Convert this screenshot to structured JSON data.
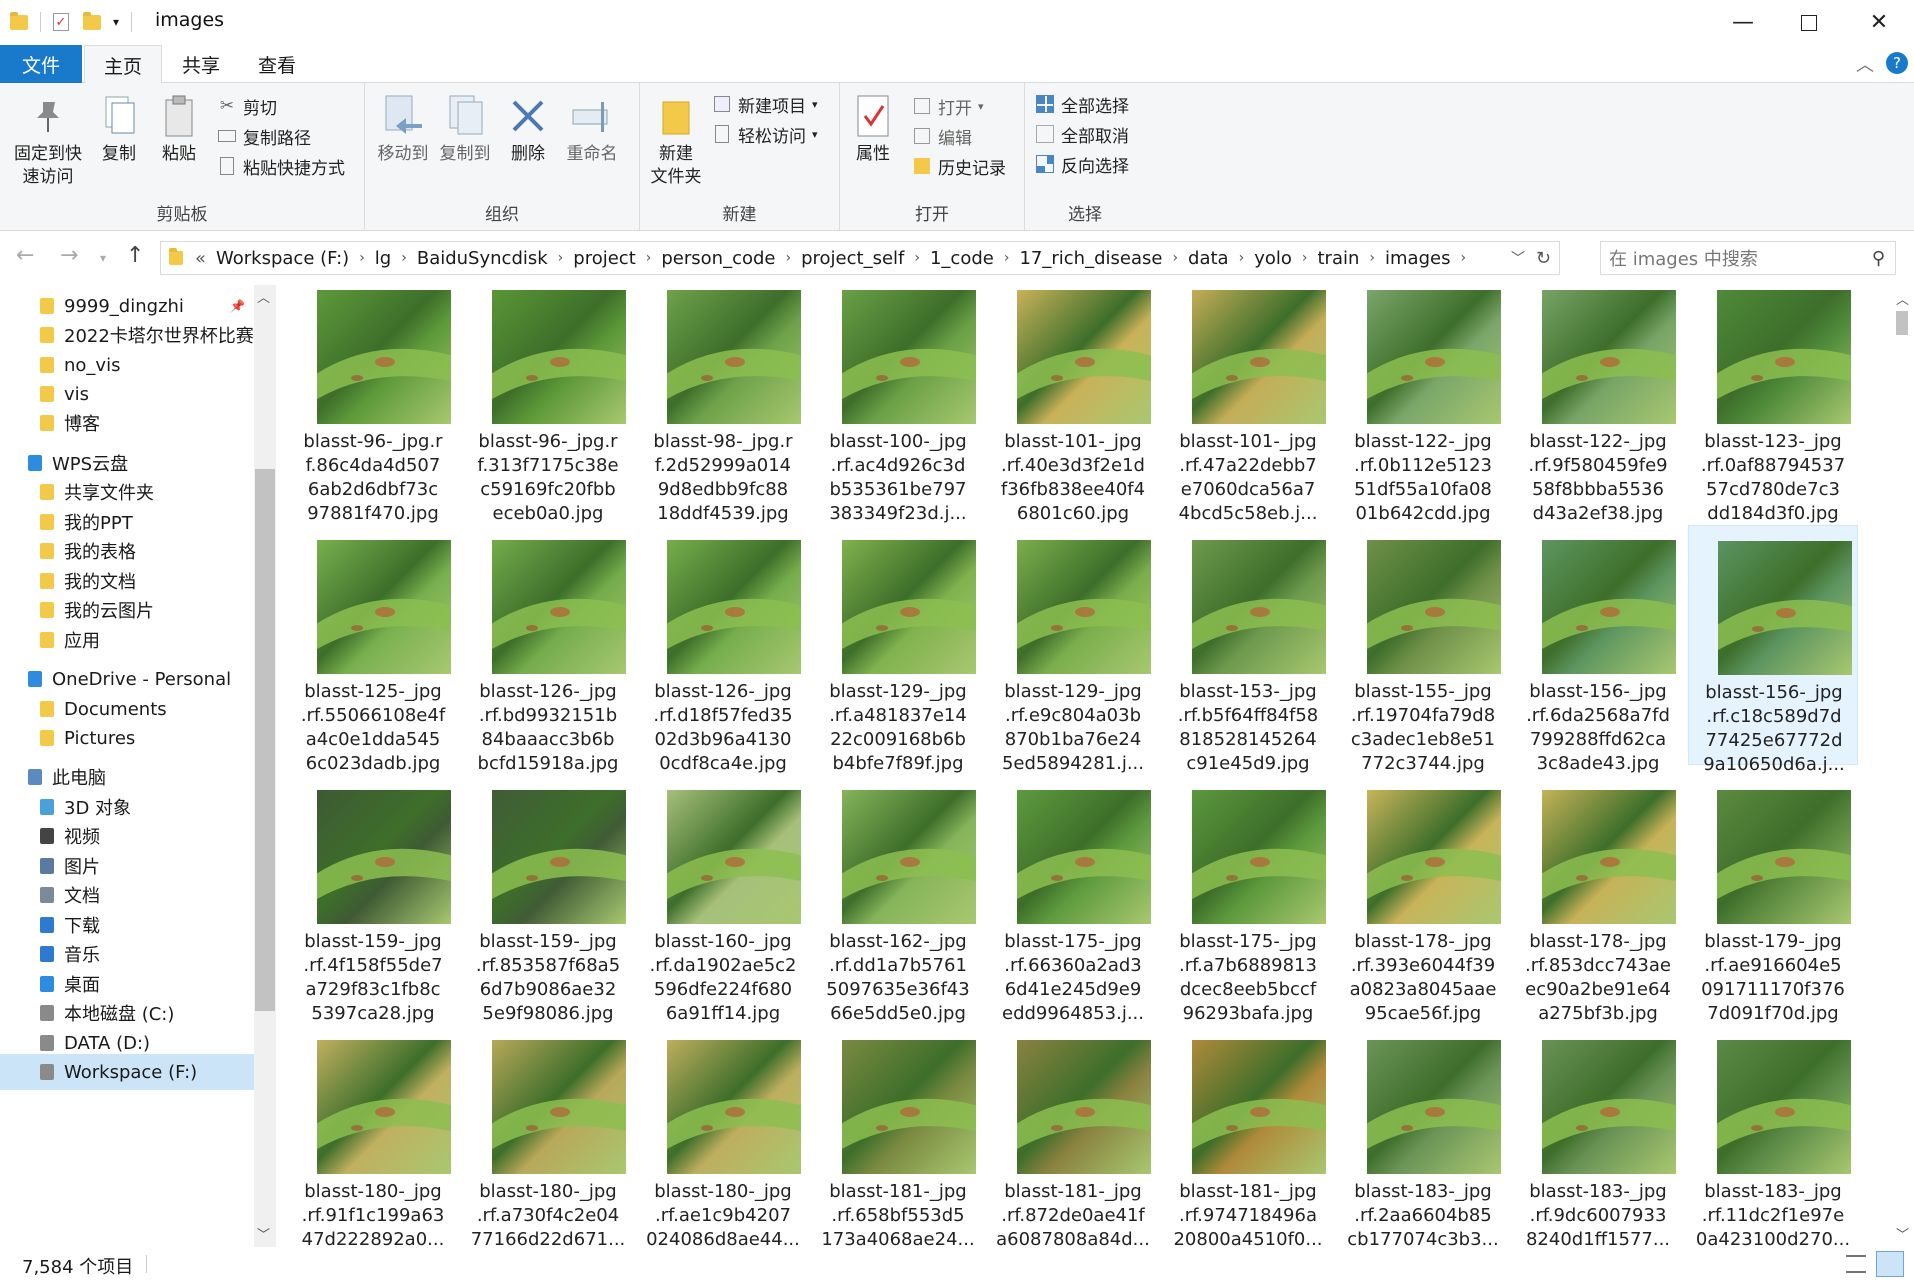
{
  "window": {
    "title": "images"
  },
  "tabs": {
    "file": "文件",
    "home": "主页",
    "share": "共享",
    "view": "查看"
  },
  "ribbon": {
    "clipboard": {
      "pin": "固定到快\n速访问",
      "copy": "复制",
      "paste": "粘贴",
      "cut": "剪切",
      "copy_path": "复制路径",
      "paste_shortcut": "粘贴快捷方式",
      "label": "剪贴板"
    },
    "organize": {
      "move_to": "移动到",
      "copy_to": "复制到",
      "delete": "删除",
      "rename": "重命名",
      "label": "组织"
    },
    "new": {
      "new_folder": "新建\n文件夹",
      "new_item": "新建项目",
      "easy_access": "轻松访问",
      "label": "新建"
    },
    "open": {
      "properties": "属性",
      "open": "打开",
      "edit": "编辑",
      "history": "历史记录",
      "label": "打开"
    },
    "select": {
      "select_all": "全部选择",
      "select_none": "全部取消",
      "invert": "反向选择",
      "label": "选择"
    }
  },
  "address": {
    "overflow": "«",
    "crumbs": [
      "Workspace (F:)",
      "lg",
      "BaiduSyncdisk",
      "project",
      "person_code",
      "project_self",
      "1_code",
      "17_rich_disease",
      "data",
      "yolo",
      "train",
      "images"
    ],
    "search_placeholder": "在 images 中搜索"
  },
  "nav": {
    "items": [
      {
        "label": "9999_dingzhi",
        "icon": "folder-icon"
      },
      {
        "label": "2022卡塔尔世界杯比赛",
        "icon": "folder-icon"
      },
      {
        "label": "no_vis",
        "icon": "folder-icon"
      },
      {
        "label": "vis",
        "icon": "folder-icon"
      },
      {
        "label": "博客",
        "icon": "folder-icon"
      },
      {
        "label": "WPS云盘",
        "icon": "cloud-icon"
      },
      {
        "label": "共享文件夹",
        "icon": "shared-folder-icon"
      },
      {
        "label": "我的PPT",
        "icon": "folder-icon"
      },
      {
        "label": "我的表格",
        "icon": "folder-icon"
      },
      {
        "label": "我的文档",
        "icon": "folder-icon"
      },
      {
        "label": "我的云图片",
        "icon": "folder-icon"
      },
      {
        "label": "应用",
        "icon": "apps-folder-icon"
      },
      {
        "label": "OneDrive - Personal",
        "icon": "onedrive-icon"
      },
      {
        "label": "Documents",
        "icon": "folder-icon"
      },
      {
        "label": "Pictures",
        "icon": "folder-icon"
      },
      {
        "label": "此电脑",
        "icon": "computer-icon"
      },
      {
        "label": "3D 对象",
        "icon": "3d-objects-icon"
      },
      {
        "label": "视频",
        "icon": "video-icon"
      },
      {
        "label": "图片",
        "icon": "pictures-icon"
      },
      {
        "label": "文档",
        "icon": "documents-icon"
      },
      {
        "label": "下载",
        "icon": "download-icon"
      },
      {
        "label": "音乐",
        "icon": "music-icon"
      },
      {
        "label": "桌面",
        "icon": "desktop-icon"
      },
      {
        "label": "本地磁盘 (C:)",
        "icon": "drive-icon"
      },
      {
        "label": "DATA (D:)",
        "icon": "drive-icon"
      },
      {
        "label": "Workspace (F:)",
        "icon": "drive-icon"
      }
    ]
  },
  "files": [
    {
      "name": "blasst-96-_jpg.r\nf.86c4da4d507\n6ab2d6dbf73c\n97881f470.jpg",
      "bg": "#5e9a3a"
    },
    {
      "name": "blasst-96-_jpg.r\nf.313f7175c38e\nc59169fc20fbb\neceb0a0.jpg",
      "bg": "#5a9636"
    },
    {
      "name": "blasst-98-_jpg.r\nf.2d52999a014\n9d8edbb9fc88\n18ddf4539.jpg",
      "bg": "#6ea24a"
    },
    {
      "name": "blasst-100-_jpg\n.rf.ac4d926c3d\nb535361be797\n383349f23d.j...",
      "bg": "#6aa046"
    },
    {
      "name": "blasst-101-_jpg\n.rf.40e3d3f2e1d\nf36fb838ee40f4\n6801c60.jpg",
      "bg": "#c9b25a"
    },
    {
      "name": "blasst-101-_jpg\n.rf.47a22debb7\ne7060dca56a7\n4bcd5c58eb.j...",
      "bg": "#c4ad58"
    },
    {
      "name": "blasst-122-_jpg\n.rf.0b112e5123\n51df55a10fa08\n01b642cdd.jpg",
      "bg": "#7aa66a"
    },
    {
      "name": "blasst-122-_jpg\n.rf.9f580459fe9\n58f8bbba5536\nd43a2ef38.jpg",
      "bg": "#77a466"
    },
    {
      "name": "blasst-123-_jpg\n.rf.0af88794537\n57cd780de7c3\ndd184d3f0.jpg",
      "bg": "#4f8a3a"
    },
    {
      "name": "blasst-125-_jpg\n.rf.55066108e4f\na4c0e1dda545\n6c023dadb.jpg",
      "bg": "#78b04e"
    },
    {
      "name": "blasst-126-_jpg\n.rf.bd9932151b\n84baaacc3b6b\nbcfd15918a.jpg",
      "bg": "#74ac4c"
    },
    {
      "name": "blasst-126-_jpg\n.rf.d18f57fed35\n02d3b96a4130\n0cdf8ca4e.jpg",
      "bg": "#76ae4c"
    },
    {
      "name": "blasst-129-_jpg\n.rf.a481837e14\n22c009168b6b\nb4bfe7f89f.jpg",
      "bg": "#80b24e"
    },
    {
      "name": "blasst-129-_jpg\n.rf.e9c804a03b\n870b1ba76e24\n5ed5894281.j...",
      "bg": "#7aae4c"
    },
    {
      "name": "blasst-153-_jpg\n.rf.b5f64ff84f58\n818528145264\nc91e45d9.jpg",
      "bg": "#6e9a4e"
    },
    {
      "name": "blasst-155-_jpg\n.rf.19704fa79d8\nc3adec1eb8e51\n772c3744.jpg",
      "bg": "#6f9048"
    },
    {
      "name": "blasst-156-_jpg\n.rf.6da2568a7fd\n799288ffd62ca\n3c8ade43.jpg",
      "bg": "#5e9660"
    },
    {
      "name": "blasst-156-_jpg\n.rf.c18c589d7d\n77425e67772d\n9a10650d6a.j...",
      "bg": "#5c9460"
    },
    {
      "name": "blasst-159-_jpg\n.rf.4f158f55de7\na729f83c1fb8c\n5397ca28.jpg",
      "bg": "#3e5a34"
    },
    {
      "name": "blasst-159-_jpg\n.rf.853587f68a5\n6d7b9086ae32\n5e9f98086.jpg",
      "bg": "#405c36"
    },
    {
      "name": "blasst-160-_jpg\n.rf.da1902ae5c2\n596dfe224f680\n6a91ff14.jpg",
      "bg": "#a6c07a"
    },
    {
      "name": "blasst-162-_jpg\n.rf.dd1a7b5761\n5097635e36f43\n66e5dd5e0.jpg",
      "bg": "#86b45a"
    },
    {
      "name": "blasst-175-_jpg\n.rf.66360a2ad3\n6d41e245d9e9\nedd9964853.j...",
      "bg": "#5e9a3e"
    },
    {
      "name": "blasst-175-_jpg\n.rf.a7b6889813\ndcec8eeb5bccf\n96293bafa.jpg",
      "bg": "#5c983c"
    },
    {
      "name": "blasst-178-_jpg\n.rf.393e6044f39\na0823a8045aae\n95cae56f.jpg",
      "bg": "#c8b45a"
    },
    {
      "name": "blasst-178-_jpg\n.rf.853dcc743ae\nec90a2be91e64\na275bf3b.jpg",
      "bg": "#c6b258"
    },
    {
      "name": "blasst-179-_jpg\n.rf.ae916604e5\n091711170f376\n7d091f70d.jpg",
      "bg": "#5c8a40"
    },
    {
      "name": "blasst-180-_jpg\n.rf.91f1c199a63\n47d222892a0...",
      "bg": "#c0b060"
    },
    {
      "name": "blasst-180-_jpg\n.rf.a730f4c2e04\n77166d22d671...",
      "bg": "#b8a85a"
    },
    {
      "name": "blasst-180-_jpg\n.rf.ae1c9b4207\n024086d8ae44...",
      "bg": "#beae5e"
    },
    {
      "name": "blasst-181-_jpg\n.rf.658bf553d5\n173a4068ae24...",
      "bg": "#7a8a40"
    },
    {
      "name": "blasst-181-_jpg\n.rf.872de0ae41f\na6087808a84d...",
      "bg": "#8a8240"
    },
    {
      "name": "blasst-181-_jpg\n.rf.974718496a\n20800a4510f0...",
      "bg": "#b08a3a"
    },
    {
      "name": "blasst-183-_jpg\n.rf.2aa6604b85\ncb177074c3b3...",
      "bg": "#6c9458"
    },
    {
      "name": "blasst-183-_jpg\n.rf.9dc6007933\n8240d1ff1577...",
      "bg": "#6a9256"
    },
    {
      "name": "blasst-183-_jpg\n.rf.11dc2f1e97e\n0a423100d270...",
      "bg": "#5a8a46"
    }
  ],
  "status": {
    "count": "7,584 个项目"
  },
  "colors": {
    "accent": "#1979ca",
    "selection": "#e5f3ff"
  }
}
